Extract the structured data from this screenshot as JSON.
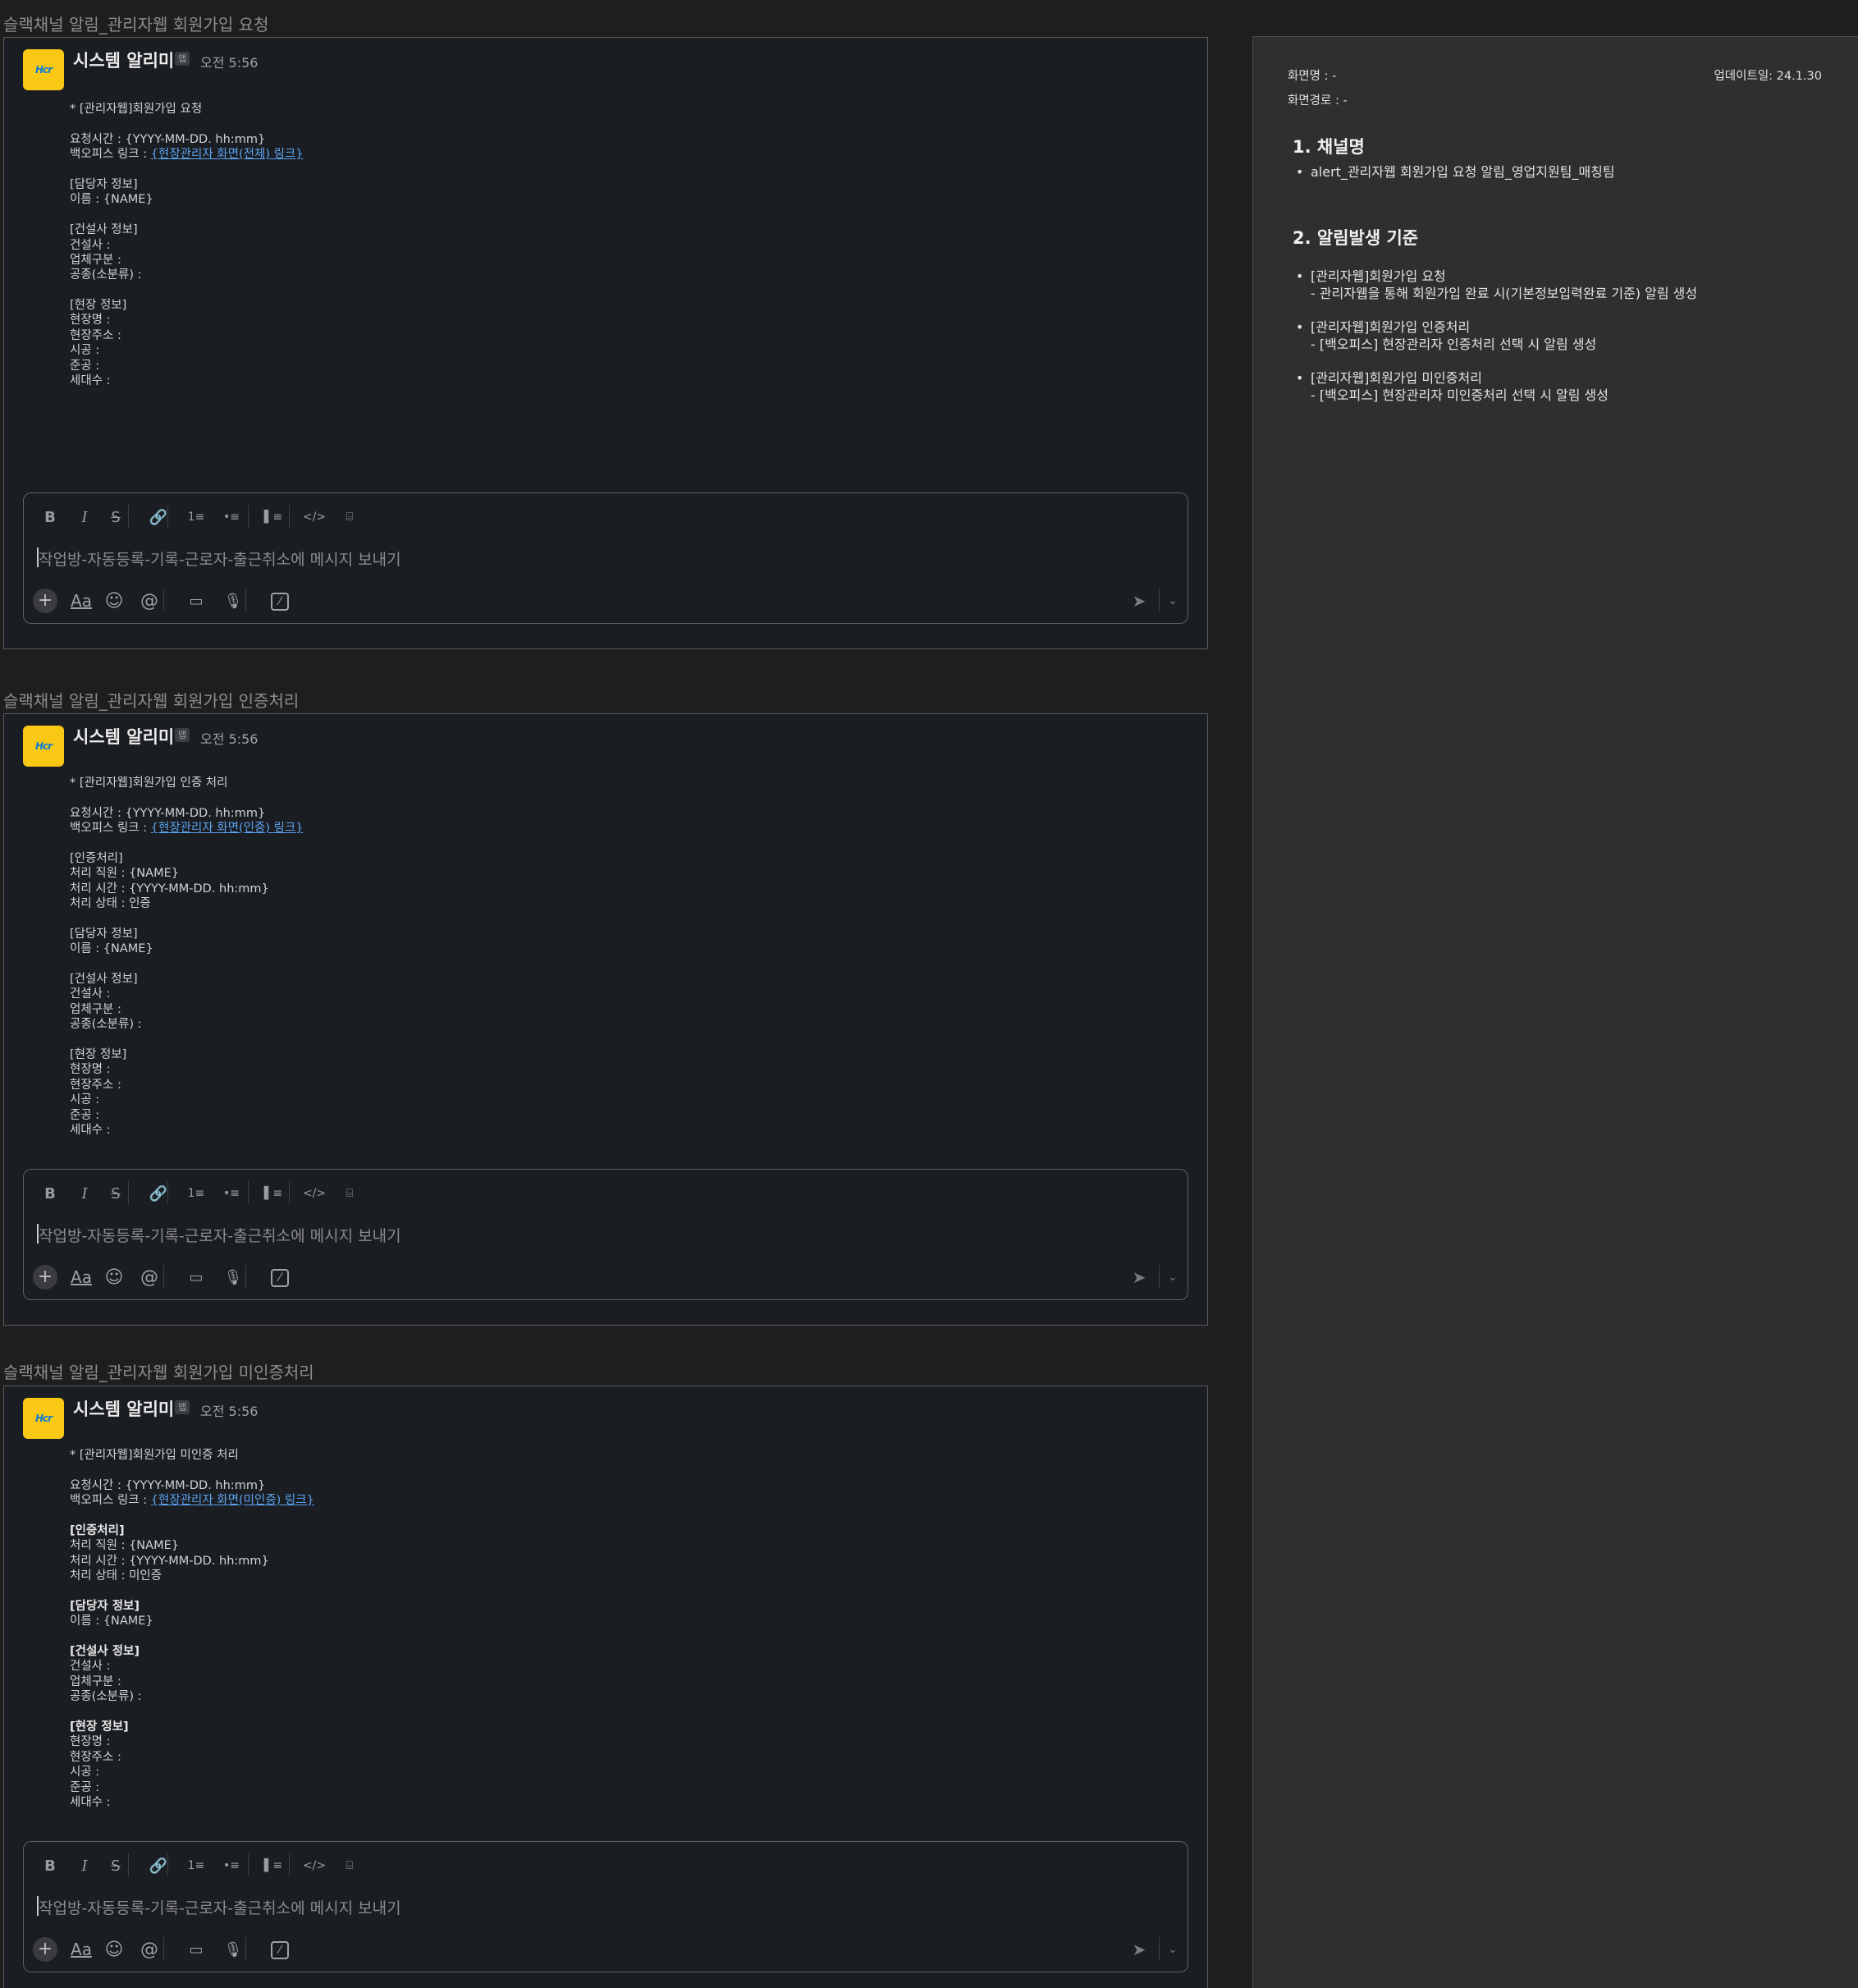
{
  "sections": [
    {
      "title": "슬랙채널 알림_관리자웹 회원가입 요청",
      "sender": "시스템 알리미",
      "app_badge": "앱",
      "time": "오전 5:56",
      "avatar_text": "Hcr",
      "lines": [
        {
          "t": "* [관리자웹]회원가입 요청"
        },
        {
          "t": ""
        },
        {
          "t": "요청시간 : {YYYY-MM-DD. hh:mm}"
        },
        {
          "t": "백오피스 링크 : ",
          "link": "{현장관리자 화면(전체) 링크}"
        },
        {
          "t": ""
        },
        {
          "t": "[담당자 정보]"
        },
        {
          "t": "이름 : {NAME}"
        },
        {
          "t": ""
        },
        {
          "t": "[건설사 정보]"
        },
        {
          "t": "건설사 :"
        },
        {
          "t": "업체구분 :"
        },
        {
          "t": "공종(소분류) :"
        },
        {
          "t": ""
        },
        {
          "t": "[현장 정보]"
        },
        {
          "t": "현장명 :"
        },
        {
          "t": "현장주소 :"
        },
        {
          "t": "시공 :"
        },
        {
          "t": "준공 :"
        },
        {
          "t": "세대수 :"
        }
      ],
      "placeholder": "작업방-자동등록-기록-근로자-출근취소에 메시지 보내기"
    },
    {
      "title": "슬랙채널 알림_관리자웹 회원가입 인증처리",
      "sender": "시스템 알리미",
      "app_badge": "앱",
      "time": "오전 5:56",
      "avatar_text": "Hcr",
      "lines": [
        {
          "t": "* [관리자웹]회원가입 인증 처리"
        },
        {
          "t": ""
        },
        {
          "t": "요청시간 : {YYYY-MM-DD. hh:mm}"
        },
        {
          "t": "백오피스 링크 : ",
          "link": "{현장관리자 화면(인증) 링크}"
        },
        {
          "t": ""
        },
        {
          "t": "[인증처리]"
        },
        {
          "t": "처리 직원 : {NAME}"
        },
        {
          "t": "처리 시간 : {YYYY-MM-DD. hh:mm}"
        },
        {
          "t": "처리 상태 : 인증"
        },
        {
          "t": ""
        },
        {
          "t": "[담당자 정보]"
        },
        {
          "t": "이름 : {NAME}"
        },
        {
          "t": ""
        },
        {
          "t": "[건설사 정보]"
        },
        {
          "t": "건설사 :"
        },
        {
          "t": "업체구분 :"
        },
        {
          "t": "공종(소분류) :"
        },
        {
          "t": ""
        },
        {
          "t": "[현장 정보]"
        },
        {
          "t": "현장명 :"
        },
        {
          "t": "현장주소 :"
        },
        {
          "t": "시공 :"
        },
        {
          "t": "준공 :"
        },
        {
          "t": "세대수 :"
        }
      ],
      "placeholder": "작업방-자동등록-기록-근로자-출근취소에 메시지 보내기"
    },
    {
      "title": "슬랙채널 알림_관리자웹 회원가입 미인증처리",
      "sender": "시스템 알리미",
      "app_badge": "앱",
      "time": "오전 5:56",
      "avatar_text": "Hcr",
      "lines": [
        {
          "t": "* [관리자웹]회원가입 미인증 처리"
        },
        {
          "t": ""
        },
        {
          "t": "요청시간 : {YYYY-MM-DD. hh:mm}"
        },
        {
          "t": "백오피스 링크 : ",
          "link": "{현장관리자 화면(미인증) 링크}"
        },
        {
          "t": ""
        },
        {
          "t": "[인증처리]",
          "bold": true
        },
        {
          "t": "처리 직원 : {NAME}"
        },
        {
          "t": "처리 시간 : {YYYY-MM-DD. hh:mm}"
        },
        {
          "t": "처리 상태 : 미인증"
        },
        {
          "t": ""
        },
        {
          "t": "[담당자 정보]",
          "bold": true
        },
        {
          "t": "이름 : {NAME}"
        },
        {
          "t": ""
        },
        {
          "t": "[건설사 정보]",
          "bold": true
        },
        {
          "t": "건설사 :"
        },
        {
          "t": "업체구분 :"
        },
        {
          "t": "공종(소분류) :"
        },
        {
          "t": ""
        },
        {
          "t": "[현장 정보]",
          "bold": true
        },
        {
          "t": "현장명 :"
        },
        {
          "t": "현장주소 :"
        },
        {
          "t": "시공 :"
        },
        {
          "t": "준공 :"
        },
        {
          "t": "세대수 :"
        }
      ],
      "placeholder": "작업방-자동등록-기록-근로자-출근취소에 메시지 보내기"
    }
  ],
  "composer_icons": {
    "format": [
      "bold-icon",
      "italic-icon",
      "strikethrough-icon",
      "link-icon",
      "ordered-list-icon",
      "bulleted-list-icon",
      "blockquote-icon",
      "code-icon",
      "code-block-icon"
    ],
    "format_glyphs": [
      "B",
      "I",
      "S",
      "🔗",
      "1≡",
      "•≡",
      "▌≡",
      "</>",
      "⌸"
    ],
    "bottom": [
      "plus-icon",
      "text-format-icon",
      "emoji-icon",
      "mention-icon",
      "video-icon",
      "microphone-icon",
      "slash-command-icon"
    ],
    "bottom_glyphs": [
      "+",
      "Aa",
      "☺",
      "@",
      "▭",
      "🎙",
      "⁄"
    ],
    "send_glyph": "➤",
    "send_options_glyph": "⌄"
  },
  "right_panel": {
    "screen_name": "화면명 : -",
    "screen_path": "화면경로 : -",
    "update_date": "업데이트일: 24.1.30",
    "heading1": "1. 채널명",
    "channel": "alert_관리자웹 회원가입 요청 알림_영업지원팀_매칭팀",
    "heading2": "2. 알림발생 기준",
    "criteria": [
      {
        "title": "[관리자웹]회원가입 요청",
        "desc": "- 관리자웹을 통해 회원가입 완료 시(기본정보입력완료 기준) 알림 생성"
      },
      {
        "title": "[관리자웹]회원가입 인증처리",
        "desc": "- [백오피스] 현장관리자 인증처리 선택 시 알림 생성"
      },
      {
        "title": "[관리자웹]회원가입 미인증처리",
        "desc": "- [백오피스] 현장관리자 미인증처리 선택 시 알림 생성"
      }
    ]
  }
}
